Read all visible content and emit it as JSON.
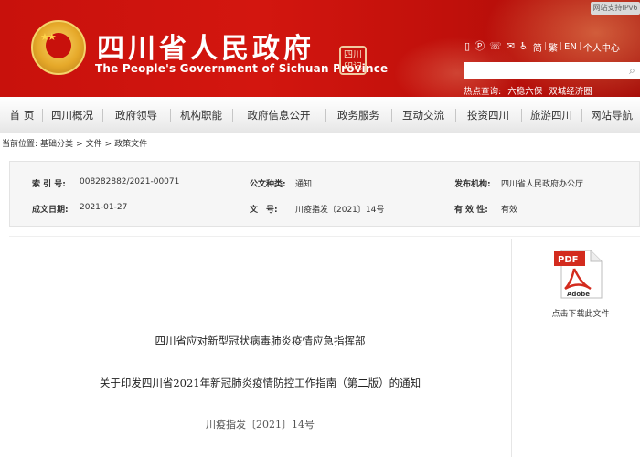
{
  "header": {
    "title": "四川省人民政府",
    "subtitle": "The People's Government of Sichuan Province",
    "seal_text": "四川 印记",
    "support_label": "网站支持IPv6",
    "tools": {
      "lang_simplified": "简",
      "lang_traditional": "繁",
      "lang_english": "EN",
      "personal_center": "个人中心"
    },
    "search": {
      "placeholder": "",
      "button_icon": "search-icon"
    },
    "hot": {
      "label": "热点查询:",
      "items": [
        "六稳六保",
        "双城经济圈"
      ]
    }
  },
  "nav": {
    "items": [
      "首 页",
      "四川概况",
      "政府领导",
      "机构职能",
      "政府信息公开",
      "政务服务",
      "互动交流",
      "投资四川",
      "旅游四川",
      "网站导航"
    ]
  },
  "breadcrumb": {
    "label": "当前位置:",
    "items": [
      "基础分类",
      "文件",
      "政策文件"
    ],
    "separator": ">"
  },
  "meta": {
    "index_label": "索 引 号:",
    "index_value": "008282882/2021-00071",
    "category_label": "公文种类:",
    "category_value": "通知",
    "publisher_label": "发布机构:",
    "publisher_value": "四川省人民政府办公厅",
    "date_label": "成文日期:",
    "date_value": "2021-01-27",
    "doc_no_label": "文　号:",
    "doc_no_value": "川疫指发〔2021〕14号",
    "validity_label": "有 效 性:",
    "validity_value": "有效"
  },
  "document": {
    "issuer": "四川省应对新型冠状病毒肺炎疫情应急指挥部",
    "title": "关于印发四川省2021年新冠肺炎疫情防控工作指南（第二版）的通知",
    "number": "川疫指发〔2021〕14号"
  },
  "download": {
    "icon_text_pdf": "PDF",
    "icon_text_adobe": "Adobe",
    "caption": "点击下载此文件"
  },
  "colors": {
    "header_red": "#c8110c",
    "emblem_gold": "#e6a92a",
    "pdf_red": "#d32b1e"
  }
}
